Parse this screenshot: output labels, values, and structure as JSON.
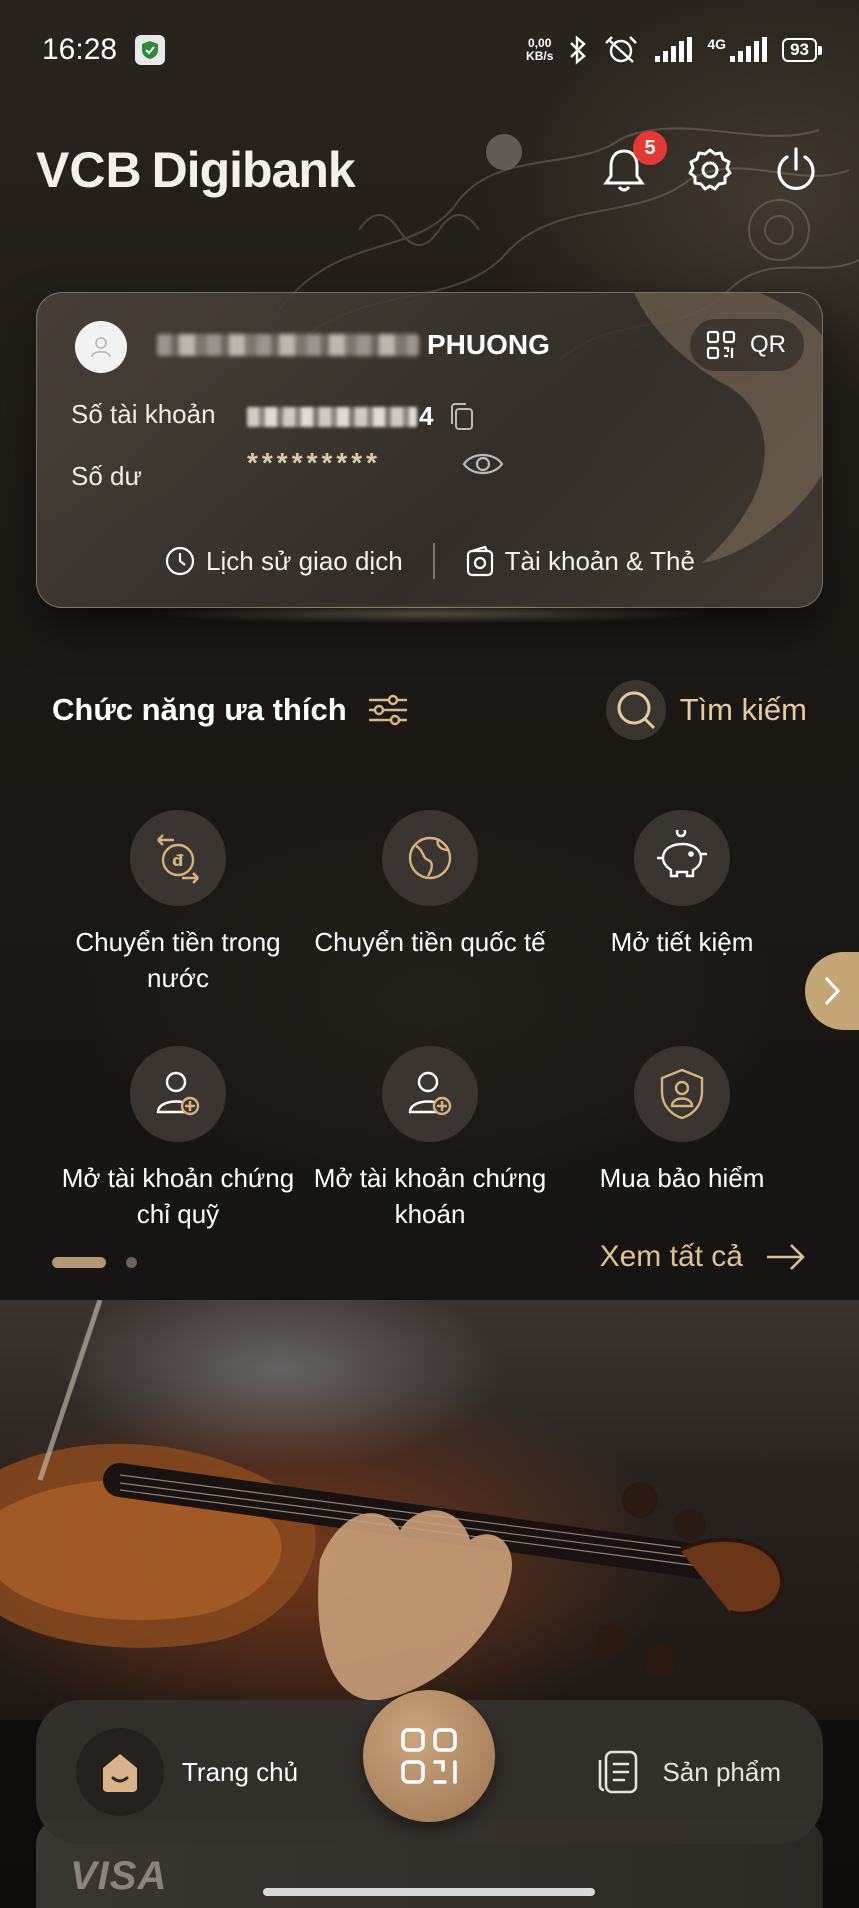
{
  "status_bar": {
    "time": "16:28",
    "net_speed_value": "0,00",
    "net_speed_unit": "KB/s",
    "network": "4G",
    "battery": "93"
  },
  "header": {
    "logo_vcb": "VCB",
    "logo_digibank": "Digibank",
    "notification_count": "5"
  },
  "account_card": {
    "name_suffix": "PHUONG",
    "qr_label": "QR",
    "account_number_label": "Số tài khoản",
    "account_number_tail": "4",
    "balance_label": "Số dư",
    "balance_masked": "*********",
    "history_label": "Lịch sử giao dịch",
    "accounts_cards_label": "Tài khoản & Thẻ"
  },
  "favorites": {
    "title": "Chức năng ưa thích",
    "search_label": "Tìm kiếm",
    "items": [
      {
        "label": "Chuyển tiền trong nước",
        "icon": "domestic-transfer-icon"
      },
      {
        "label": "Chuyển tiền quốc tế",
        "icon": "globe-icon"
      },
      {
        "label": "Mở tiết kiệm",
        "icon": "piggy-bank-icon"
      },
      {
        "label": "Mở tài khoản chứng chỉ quỹ",
        "icon": "add-user-icon"
      },
      {
        "label": "Mở tài khoản chứng khoán",
        "icon": "add-user-icon"
      },
      {
        "label": "Mua bảo hiểm",
        "icon": "shield-user-icon"
      }
    ],
    "see_all_label": "Xem tất cả",
    "page_index": 1,
    "page_count": 2
  },
  "bottom_nav": {
    "home_label": "Trang chủ",
    "products_label": "Sản phẩm"
  },
  "promo_card": {
    "brand": "VISA"
  },
  "colors": {
    "accent_gold": "#c5a676",
    "accent_text": "#e0c095",
    "badge_red": "#e53935"
  }
}
